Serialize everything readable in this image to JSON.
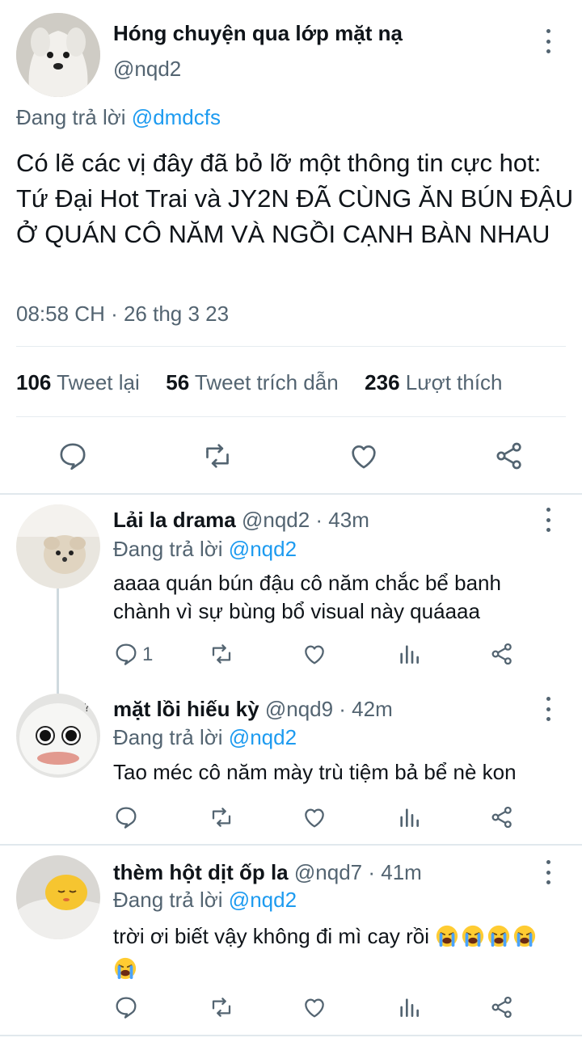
{
  "main_tweet": {
    "display_name": "Hóng chuyện qua lớp mặt nạ",
    "handle": "@nqd2",
    "reply_prefix": "Đang trả lời",
    "reply_to": "@dmdcfs",
    "text": "Có lẽ các vị đây đã bỏ lỡ một thông tin cực hot: Tứ Đại Hot Trai và JY2N ĐÃ CÙNG ĂN BÚN ĐẬU Ở QUÁN CÔ NĂM VÀ NGỒI CẠNH BÀN NHAU",
    "timestamp": "08:58 CH · 26 thg 3 23",
    "stats": {
      "retweets_count": "106",
      "retweets_label": "Tweet lại",
      "quotes_count": "56",
      "quotes_label": "Tweet trích dẫn",
      "likes_count": "236",
      "likes_label": "Lượt thích"
    }
  },
  "replies": [
    {
      "display_name": "Lải la drama",
      "handle": "@nqd2",
      "time": " · 43m",
      "reply_prefix": "Đang trả lời",
      "reply_to": "@nqd2",
      "text": "aaaa quán bún đậu cô năm chắc bể banh chành vì sự bùng bổ visual này quáaaa",
      "reply_count": "1"
    },
    {
      "display_name": "mặt lồi hiếu kỳ",
      "handle": "@nqd9",
      "time": " · 42m",
      "reply_prefix": "Đang trả lời",
      "reply_to": "@nqd2",
      "text": "Tao méc cô năm mày trù tiệm bả bể nè kon"
    },
    {
      "display_name": "thèm hột dịt ốp la",
      "handle": "@nqd7",
      "time": " · 41m",
      "reply_prefix": "Đang trả lời",
      "reply_to": "@nqd2",
      "text": "trời ơi biết vậy không đi mì cay rồi",
      "emoji": "loudly-crying-face"
    }
  ],
  "colors": {
    "text": "#0f1419",
    "secondary": "#536471",
    "accent": "#1d9bf0"
  }
}
